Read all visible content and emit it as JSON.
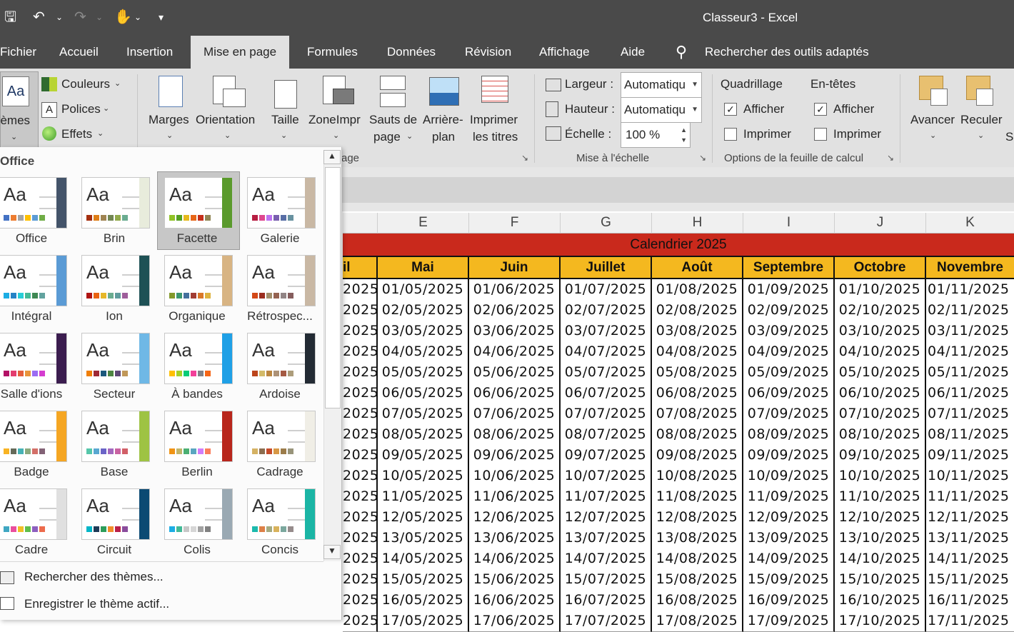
{
  "window": {
    "title": "Classeur3  -  Excel"
  },
  "tabs": [
    "Fichier",
    "Accueil",
    "Insertion",
    "Mise en page",
    "Formules",
    "Données",
    "Révision",
    "Affichage",
    "Aide"
  ],
  "active_tab": "Mise en page",
  "tell_me": "Rechercher des outils adaptés",
  "ribbon": {
    "themes_label": "Thèmes",
    "colors": "Couleurs",
    "fonts": "Polices",
    "effects": "Effets",
    "margins": "Marges",
    "orientation": "Orientation",
    "size": "Taille",
    "print_area": "ZoneImpr",
    "breaks_1": "Sauts de",
    "breaks_2": "page",
    "background_1": "Arrière-",
    "background_2": "plan",
    "print_titles_1": "Imprimer",
    "print_titles_2": "les titres",
    "page_setup_group": "age",
    "width_label": "Largeur :",
    "width_value": "Automatiqu",
    "height_label": "Hauteur :",
    "height_value": "Automatiqu",
    "scale_label": "Échelle :",
    "scale_value": "100 %",
    "scale_group": "Mise à l'échelle",
    "gridlines": "Quadrillage",
    "headings": "En-têtes",
    "view": "Afficher",
    "print": "Imprimer",
    "sheet_options_group": "Options de la feuille de calcul",
    "bring_forward": "Avancer",
    "send_backward": "Reculer",
    "selection_pane_partial": "Se"
  },
  "gallery": {
    "header": "Office",
    "themes": [
      {
        "name": "Office",
        "colors": [
          "#4472c4",
          "#ed7d31",
          "#a5a5a5",
          "#ffc000",
          "#5b9bd5",
          "#70ad47"
        ],
        "stripe": "#44546a"
      },
      {
        "name": "Brin",
        "colors": [
          "#a53010",
          "#de7e18",
          "#9f8351",
          "#728653",
          "#92aa4c",
          "#6aac91"
        ],
        "stripe": "#e8ecdc"
      },
      {
        "name": "Facette",
        "colors": [
          "#90c226",
          "#54a021",
          "#e6b91e",
          "#e76618",
          "#c42f1a",
          "#918655"
        ],
        "stripe": "#5a9a2c"
      },
      {
        "name": "Galerie",
        "colors": [
          "#b71e42",
          "#de478e",
          "#bc72f0",
          "#795faf",
          "#586ea6",
          "#6892a0"
        ],
        "stripe": "#c9b8a4"
      },
      {
        "name": "Intégral",
        "colors": [
          "#1cade4",
          "#2683c6",
          "#27ced7",
          "#42ba97",
          "#3e8853",
          "#62a39f"
        ],
        "stripe": "#5b9bd5"
      },
      {
        "name": "Ion",
        "colors": [
          "#b01513",
          "#ea6312",
          "#e6b729",
          "#6aac90",
          "#5f9c9d",
          "#9e5e9b"
        ],
        "stripe": "#1e5155"
      },
      {
        "name": "Organique",
        "colors": [
          "#83992a",
          "#3c9770",
          "#44709d",
          "#a23c33",
          "#d97828",
          "#deb340"
        ],
        "stripe": "#d8b483"
      },
      {
        "name": "Rétrospec...",
        "colors": [
          "#d34817",
          "#9b2d1f",
          "#a28e6a",
          "#956251",
          "#918485",
          "#855d5d"
        ],
        "stripe": "#c9b8a4"
      },
      {
        "name": "Salle d'ions",
        "colors": [
          "#b31166",
          "#e33d6f",
          "#e45f3c",
          "#e9943a",
          "#9b6bf2",
          "#d53dd0"
        ],
        "stripe": "#3b1d4f"
      },
      {
        "name": "Secteur",
        "colors": [
          "#f07f09",
          "#9f2936",
          "#1b587c",
          "#4e8542",
          "#604878",
          "#c19859"
        ],
        "stripe": "#6fb8e6"
      },
      {
        "name": "À bandes",
        "colors": [
          "#ffc000",
          "#a5d028",
          "#08cc78",
          "#f24099",
          "#828288",
          "#f56617"
        ],
        "stripe": "#1fa0e6"
      },
      {
        "name": "Ardoise",
        "colors": [
          "#bc451b",
          "#d3ba68",
          "#bb8640",
          "#ad9277",
          "#a55a43",
          "#ad9d7b"
        ],
        "stripe": "#232b34"
      },
      {
        "name": "Badge",
        "colors": [
          "#f8b323",
          "#656a59",
          "#46b2b5",
          "#8caa7e",
          "#d36f68",
          "#826276"
        ],
        "stripe": "#f5a623"
      },
      {
        "name": "Base",
        "colors": [
          "#56c7aa",
          "#59a8d1",
          "#6b64c7",
          "#a369be",
          "#c963a2",
          "#d15f67"
        ],
        "stripe": "#9ec343"
      },
      {
        "name": "Berlin",
        "colors": [
          "#f09415",
          "#c1b56b",
          "#4baf73",
          "#5aa6c0",
          "#d17df9",
          "#fa7e5c"
        ],
        "stripe": "#b8261c"
      },
      {
        "name": "Cadrage",
        "colors": [
          "#d5b264",
          "#8c6d4f",
          "#c64b2a",
          "#d79846",
          "#9c7c4a",
          "#98947a"
        ],
        "stripe": "#f0eee6"
      },
      {
        "name": "Cadre",
        "colors": [
          "#40a7c2",
          "#ea4e9d",
          "#f1bf27",
          "#5fbe4c",
          "#8d5fbf",
          "#ed6b4c"
        ],
        "stripe": "#e0e0e0"
      },
      {
        "name": "Circuit",
        "colors": [
          "#03b6c8",
          "#1f3b57",
          "#2c9d5a",
          "#f28e2b",
          "#b9204a",
          "#8a4c9c"
        ],
        "stripe": "#0b4a73"
      },
      {
        "name": "Colis",
        "colors": [
          "#1cade4",
          "#42ba97",
          "#c7c7c7",
          "#d6d6d6",
          "#a2a2a2",
          "#828282"
        ],
        "stripe": "#9aa9b3"
      },
      {
        "name": "Concis",
        "colors": [
          "#1cbaad",
          "#dd8047",
          "#a5ab81",
          "#d8b25c",
          "#7ba79d",
          "#968c8c"
        ],
        "stripe": "#1bb5a5"
      }
    ],
    "footer": [
      "Rechercher des thèmes...",
      "Enregistrer le thème actif..."
    ]
  },
  "sheet": {
    "column_letters": [
      "E",
      "F",
      "G",
      "H",
      "I",
      "J",
      "K"
    ],
    "calendar_title": "Calendrier 2025",
    "months": [
      "il",
      "Mai",
      "Juin",
      "Juillet",
      "Août",
      "Septembre",
      "Octobre",
      "Novembre"
    ],
    "rows": [
      [
        "2025",
        "01/05/2025",
        "01/06/2025",
        "01/07/2025",
        "01/08/2025",
        "01/09/2025",
        "01/10/2025",
        "01/11/2025"
      ],
      [
        "2025",
        "02/05/2025",
        "02/06/2025",
        "02/07/2025",
        "02/08/2025",
        "02/09/2025",
        "02/10/2025",
        "02/11/2025"
      ],
      [
        "2025",
        "03/05/2025",
        "03/06/2025",
        "03/07/2025",
        "03/08/2025",
        "03/09/2025",
        "03/10/2025",
        "03/11/2025"
      ],
      [
        "2025",
        "04/05/2025",
        "04/06/2025",
        "04/07/2025",
        "04/08/2025",
        "04/09/2025",
        "04/10/2025",
        "04/11/2025"
      ],
      [
        "2025",
        "05/05/2025",
        "05/06/2025",
        "05/07/2025",
        "05/08/2025",
        "05/09/2025",
        "05/10/2025",
        "05/11/2025"
      ],
      [
        "2025",
        "06/05/2025",
        "06/06/2025",
        "06/07/2025",
        "06/08/2025",
        "06/09/2025",
        "06/10/2025",
        "06/11/2025"
      ],
      [
        "2025",
        "07/05/2025",
        "07/06/2025",
        "07/07/2025",
        "07/08/2025",
        "07/09/2025",
        "07/10/2025",
        "07/11/2025"
      ],
      [
        "2025",
        "08/05/2025",
        "08/06/2025",
        "08/07/2025",
        "08/08/2025",
        "08/09/2025",
        "08/10/2025",
        "08/11/2025"
      ],
      [
        "2025",
        "09/05/2025",
        "09/06/2025",
        "09/07/2025",
        "09/08/2025",
        "09/09/2025",
        "09/10/2025",
        "09/11/2025"
      ],
      [
        "2025",
        "10/05/2025",
        "10/06/2025",
        "10/07/2025",
        "10/08/2025",
        "10/09/2025",
        "10/10/2025",
        "10/11/2025"
      ],
      [
        "2025",
        "11/05/2025",
        "11/06/2025",
        "11/07/2025",
        "11/08/2025",
        "11/09/2025",
        "11/10/2025",
        "11/11/2025"
      ],
      [
        "2025",
        "12/05/2025",
        "12/06/2025",
        "12/07/2025",
        "12/08/2025",
        "12/09/2025",
        "12/10/2025",
        "12/11/2025"
      ],
      [
        "2025",
        "13/05/2025",
        "13/06/2025",
        "13/07/2025",
        "13/08/2025",
        "13/09/2025",
        "13/10/2025",
        "13/11/2025"
      ],
      [
        "2025",
        "14/05/2025",
        "14/06/2025",
        "14/07/2025",
        "14/08/2025",
        "14/09/2025",
        "14/10/2025",
        "14/11/2025"
      ],
      [
        "2025",
        "15/05/2025",
        "15/06/2025",
        "15/07/2025",
        "15/08/2025",
        "15/09/2025",
        "15/10/2025",
        "15/11/2025"
      ],
      [
        "2025",
        "16/05/2025",
        "16/06/2025",
        "16/07/2025",
        "16/08/2025",
        "16/09/2025",
        "16/10/2025",
        "16/11/2025"
      ],
      [
        "2025",
        "17/05/2025",
        "17/06/2025",
        "17/07/2025",
        "17/08/2025",
        "17/09/2025",
        "17/10/2025",
        "17/11/2025"
      ]
    ]
  },
  "colors": {
    "title_bar": "#4a4a4a",
    "ribbon": "#e1e1e1",
    "calendar_title_bg": "#c9291c",
    "month_header_bg": "#f4b81f"
  }
}
